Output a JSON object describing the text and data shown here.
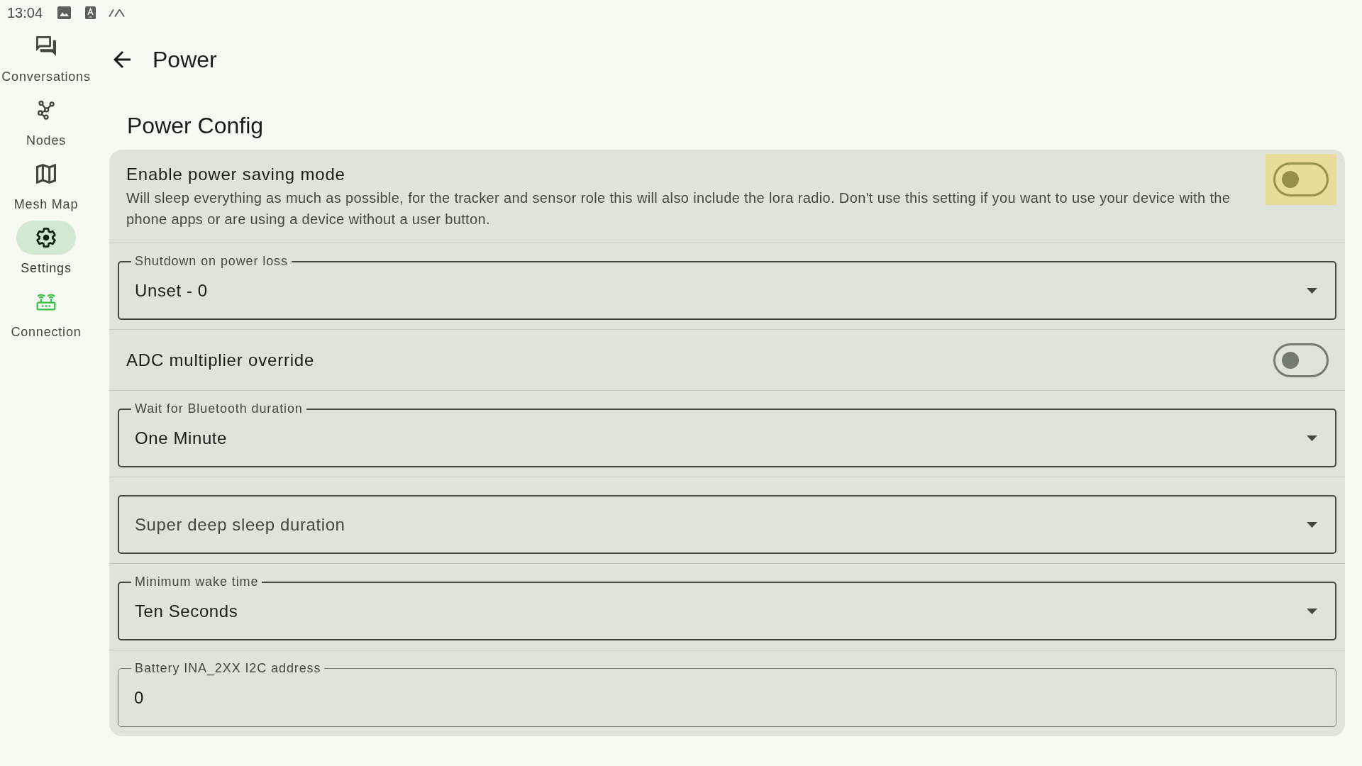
{
  "status_bar": {
    "time": "13:04"
  },
  "navigation": [
    {
      "kind": "conversations",
      "label": "Conversations",
      "selected": false
    },
    {
      "kind": "nodes",
      "label": "Nodes",
      "selected": false
    },
    {
      "kind": "map",
      "label": "Mesh Map",
      "selected": false
    },
    {
      "kind": "settings",
      "label": "Settings",
      "selected": true
    },
    {
      "kind": "connection",
      "label": "Connection",
      "selected": false,
      "connected": true
    }
  ],
  "header": {
    "title": "Power"
  },
  "section": {
    "title": "Power Config",
    "settings": [
      {
        "kind": "switch",
        "title": "Enable power saving mode",
        "description": "Will sleep everything as much as possible, for the tracker and sensor role this will also include the lora radio. Don't use this setting if you want to use your device with the phone apps or are using a device without a user button.",
        "checked": false,
        "focused": true
      },
      {
        "kind": "dropdown",
        "label": "Shutdown on power loss",
        "value": "Unset - 0"
      },
      {
        "kind": "switch",
        "title": "ADC multiplier override",
        "checked": false,
        "focused": false
      },
      {
        "kind": "dropdown",
        "label": "Wait for Bluetooth duration",
        "value": "One Minute"
      },
      {
        "kind": "dropdown",
        "placeholder": "Super deep sleep duration"
      },
      {
        "kind": "dropdown",
        "label": "Minimum wake time",
        "value": "Ten Seconds"
      },
      {
        "kind": "text_field",
        "label": "Battery INA_2XX I2C address",
        "value": "0"
      }
    ]
  }
}
